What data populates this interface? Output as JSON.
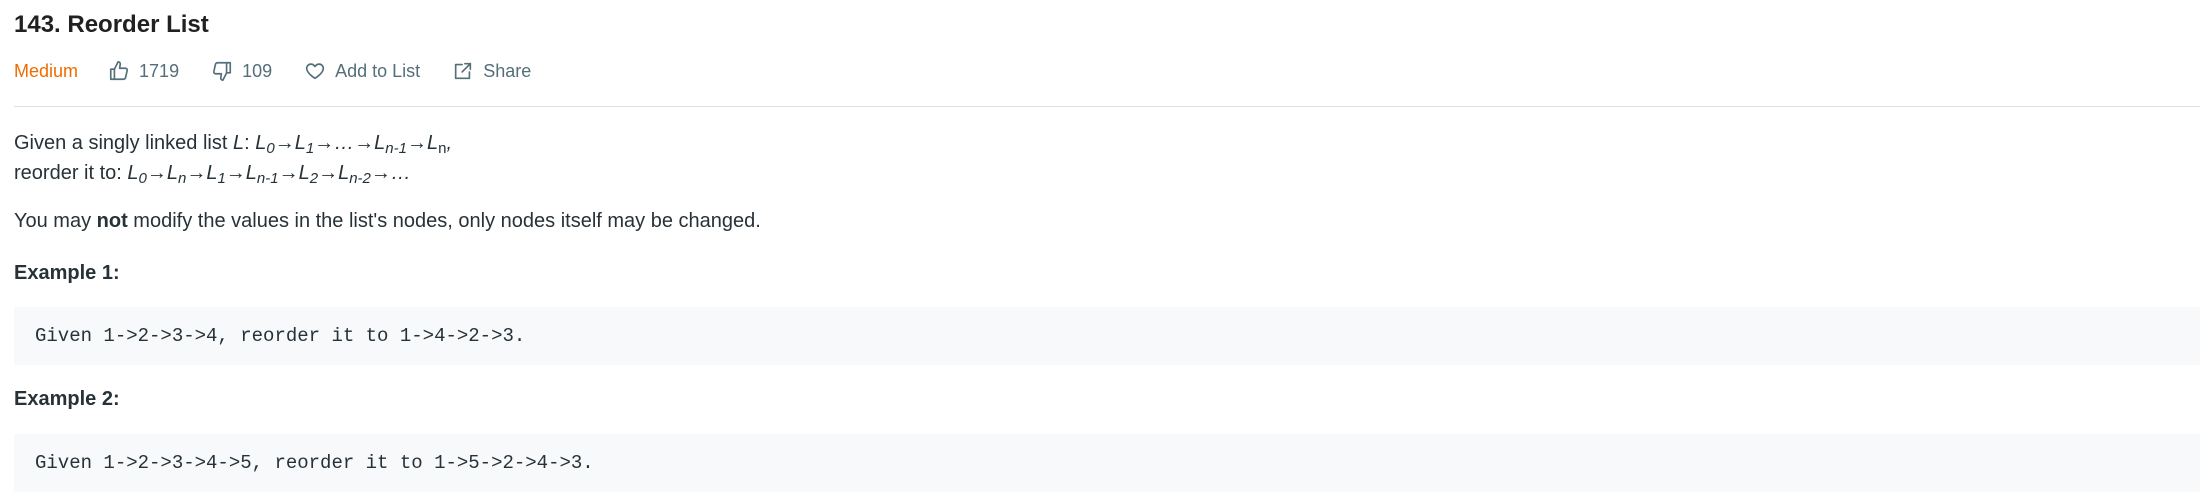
{
  "problem": {
    "title": "143. Reorder List",
    "difficulty": "Medium",
    "likes": "1719",
    "dislikes": "109",
    "add_to_list_label": "Add to List",
    "share_label": "Share"
  },
  "description": {
    "line1_prefix": "Given a singly linked list ",
    "line1_var": "L",
    "line1_colon": ": ",
    "line2_prefix": "reorder it to: ",
    "constraint_pre": "You may ",
    "constraint_bold": "not",
    "constraint_post": " modify the values in the list's nodes, only nodes itself may be changed."
  },
  "examples": [
    {
      "heading": "Example 1:",
      "code": "Given 1->2->3->4, reorder it to 1->4->2->3."
    },
    {
      "heading": "Example 2:",
      "code": "Given 1->2->3->4->5, reorder it to 1->5->2->4->3."
    }
  ],
  "colors": {
    "difficulty_medium": "#ef6c00",
    "meta_text": "#546e7a",
    "code_bg": "#f7f9fa"
  },
  "icons": [
    "thumbs-up-icon",
    "thumbs-down-icon",
    "heart-icon",
    "share-icon"
  ]
}
